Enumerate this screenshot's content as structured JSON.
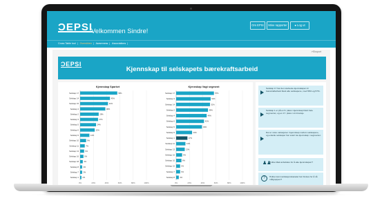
{
  "header": {
    "logo": "ƆEPSI",
    "welcome": "Velkommen Sindre!",
    "buttons": [
      "Om EPSI",
      "Mine rapporter",
      "Log ut"
    ]
  },
  "nav": {
    "items": [
      "Cross Table tool",
      "Oversikten",
      "Awareness",
      "Associations"
    ],
    "active_index": 1
  },
  "export_label": "Eksport",
  "banner": {
    "logo": "ƆEPSI",
    "title": "Kjennskap til selskapets bærekraftsarbeid"
  },
  "chart_data": [
    {
      "type": "bar",
      "orientation": "horizontal",
      "title": "Kjennskap Sparket",
      "categories": [
        "Selskap 17",
        "Selskap 14",
        "Selskap 15",
        "Selskap 4",
        "Selskap 2",
        "Selskap 3",
        "Selskap 5",
        "Selskap 6",
        "Selskap 9",
        "Selskap 10",
        "Selskap 11",
        "Selskap 13",
        "Selskap 16",
        "Selskap 18",
        "Selskap 8",
        "Selskap 7",
        "Selskap 1"
      ],
      "values": [
        56,
        45,
        42,
        38,
        28,
        27,
        24,
        22,
        14,
        9,
        7,
        6,
        5,
        4,
        3,
        3,
        2
      ],
      "value_labels": [
        "56%",
        "45%",
        "42%",
        "38%",
        "28%",
        "27%",
        "24%",
        "22%",
        "14%",
        "9%",
        "7%",
        "6%",
        "5%",
        "4%",
        "3%",
        "3%",
        "2%"
      ],
      "xlim": [
        0,
        100
      ],
      "xticks": [
        "0%",
        "20%",
        "40%",
        "60%",
        "80%",
        "100%"
      ],
      "bar_color": "#1aa5c6"
    },
    {
      "type": "bar",
      "orientation": "horizontal",
      "title": "Kjennskap Vagt segment",
      "categories": [
        "Selskap 17",
        "Selskap 3",
        "Selskap 14",
        "Selskap 2",
        "Selskap 4",
        "Selskap 6",
        "Selskap 5",
        "Selskap 9",
        "Selskap 1",
        "Selskap 11",
        "Selskap 13",
        "Selskap 16",
        "Selskap 10",
        "Selskap 15",
        "Selskap 7",
        "Selskap 8"
      ],
      "values": [
        57,
        52,
        51,
        48,
        46,
        42,
        39,
        24,
        17,
        14,
        13,
        9,
        8,
        6,
        6,
        4
      ],
      "value_labels": [
        "57%",
        "52%",
        "51%",
        "48%",
        "46%",
        "42%",
        "39%",
        "24%",
        "17%",
        "14%",
        "13%",
        "9%",
        "8%",
        "6%",
        "6%",
        "4%"
      ],
      "xlim": [
        0,
        100
      ],
      "xticks": [
        "0%",
        "20%",
        "40%",
        "60%",
        "80%",
        "100%"
      ],
      "bar_color": "#1aa5c6",
      "highlight_index": 8,
      "highlight_color": "#145466"
    }
  ],
  "insights": [
    "Selskap 17 har den sterkeste kjennskapen til bærekraftarbeid blant alle selskapene, med 56% og 57%.",
    "Selskap 1 er på en 6. plass i kjennskap blant hele segmentet, og en 17. plass i sin bransje.",
    "Det er store variasjoner i kjennskap mellom selskapene, og enkelte selskaper har svært lav kjennskap i segmentet."
  ],
  "info_boxes": [
    "Hvilke tiltak anbefales for å øke kjennskapen?",
    "Hvilke kommunikasjonskanaler bør brukes for å nå målgruppen?"
  ],
  "colors": {
    "brand": "#1aa5c6",
    "dark": "#145466",
    "nav_active": "#f6c86f",
    "panel_bg": "#d4eef6"
  }
}
